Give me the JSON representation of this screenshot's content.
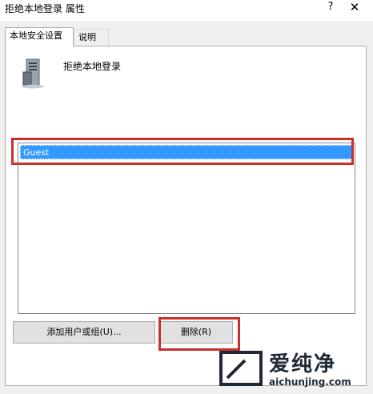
{
  "window": {
    "title": "拒绝本地登录 属性",
    "help_label": "?",
    "close_label": "✕"
  },
  "tabs": [
    {
      "label": "本地安全设置",
      "active": true
    },
    {
      "label": "说明",
      "active": false
    }
  ],
  "policy": {
    "name": "拒绝本地登录",
    "icon": "computer-tower-icon"
  },
  "users": {
    "items": [
      {
        "label": "Guest",
        "selected": true
      }
    ]
  },
  "buttons": {
    "add_label": "添加用户或组(U)...",
    "remove_label": "删除(R)"
  },
  "watermark": {
    "cn_text": "爱纯净",
    "url_text": "aichunjing.com"
  },
  "colors": {
    "selection": "#3399ff",
    "highlight": "#c9302c"
  }
}
